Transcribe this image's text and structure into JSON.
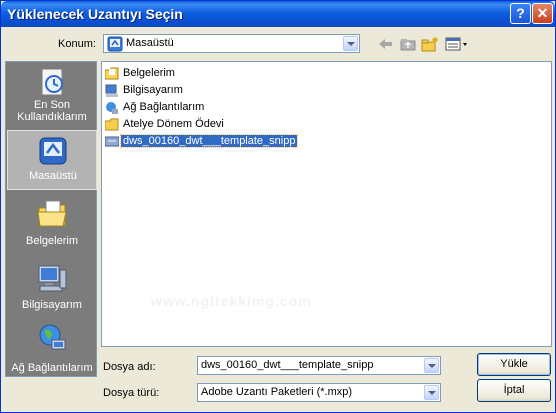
{
  "window": {
    "title": "Yüklenecek Uzantıyı Seçin",
    "help_glyph": "?",
    "close_glyph": "✕"
  },
  "location": {
    "label": "Konum:",
    "value": "Masaüstü"
  },
  "toolbar": {
    "icons": [
      "back-arrow-icon",
      "up-folder-icon",
      "new-folder-icon",
      "views-menu-icon"
    ]
  },
  "places": [
    {
      "label": "En Son Kullandıklarım",
      "icon": "recent-documents-icon"
    },
    {
      "label": "Masaüstü",
      "icon": "desktop-icon",
      "selected": true
    },
    {
      "label": "Belgelerim",
      "icon": "my-documents-icon"
    },
    {
      "label": "Bilgisayarım",
      "icon": "my-computer-icon"
    },
    {
      "label": "Ağ Bağlantılarım",
      "icon": "network-places-icon"
    }
  ],
  "files": [
    {
      "name": "Belgelerim",
      "icon": "my-documents-icon"
    },
    {
      "name": "Bilgisayarım",
      "icon": "my-computer-icon"
    },
    {
      "name": "Ağ Bağlantılarım",
      "icon": "network-places-icon"
    },
    {
      "name": "Atelye Dönem Ödevi",
      "icon": "folder-icon"
    },
    {
      "name": "dws_00160_dwt___template_snipp",
      "icon": "extension-file-icon",
      "selected": true
    }
  ],
  "filename": {
    "label": "Dosya adı:",
    "value": "dws_00160_dwt___template_snipp"
  },
  "filetype": {
    "label": "Dosya türü:",
    "value": "Adobe Uzantı Paketleri (*.mxp)"
  },
  "buttons": {
    "open": "Yükle",
    "cancel": "İptal"
  },
  "watermark": "www.ngitekkimg.com",
  "colors": {
    "title_bar": "#0a5fd8",
    "selection": "#316ac5",
    "dialog_bg": "#ece9d8",
    "places_bg": "#7c7c7c"
  }
}
